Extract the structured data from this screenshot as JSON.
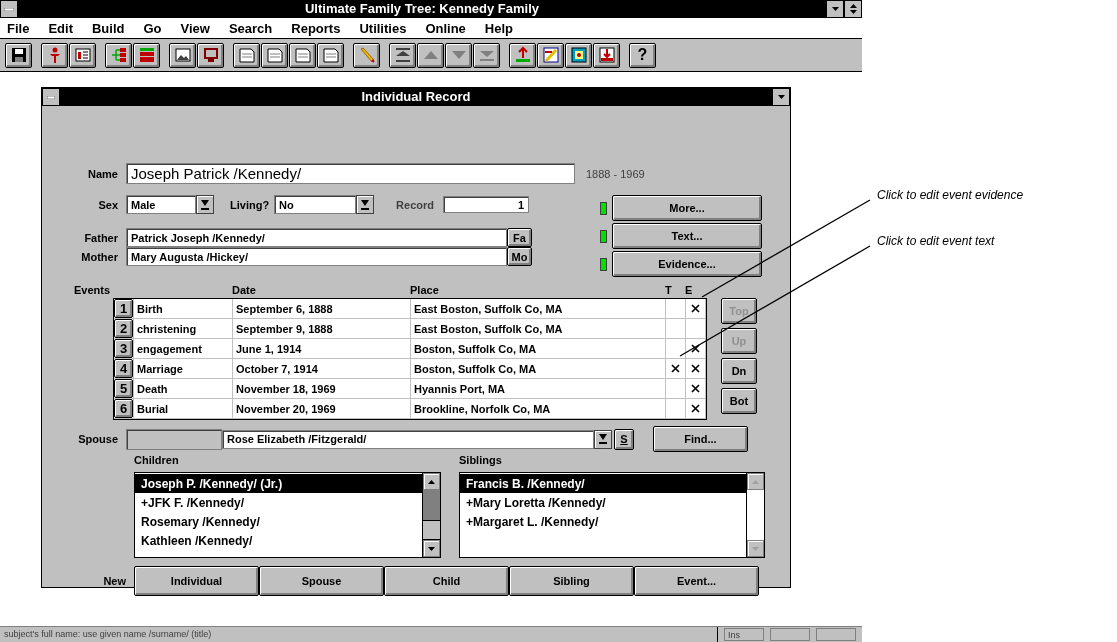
{
  "window": {
    "title": "Ultimate Family Tree: Kennedy Family"
  },
  "menu": [
    "File",
    "Edit",
    "Build",
    "Go",
    "View",
    "Search",
    "Reports",
    "Utilities",
    "Online",
    "Help"
  ],
  "toolbar": [
    [
      {
        "kind": "save"
      }
    ],
    [
      {
        "kind": "person"
      },
      {
        "kind": "card"
      }
    ],
    [
      {
        "kind": "tree"
      },
      {
        "kind": "bars"
      }
    ],
    [
      {
        "kind": "photo"
      },
      {
        "kind": "monitor"
      }
    ],
    [
      {
        "kind": "doc"
      },
      {
        "kind": "doc"
      },
      {
        "kind": "doc"
      },
      {
        "kind": "doc"
      }
    ],
    [
      {
        "kind": "pencil"
      }
    ],
    [
      {
        "kind": "top"
      },
      {
        "kind": "up"
      },
      {
        "kind": "down"
      },
      {
        "kind": "bottom"
      }
    ],
    [
      {
        "kind": "ancestor"
      },
      {
        "kind": "edit"
      },
      {
        "kind": "frame"
      },
      {
        "kind": "descend"
      }
    ],
    [
      {
        "kind": "help",
        "label": "?"
      }
    ]
  ],
  "dialog": {
    "title": "Individual Record",
    "name": {
      "label": "Name",
      "value": "Joseph Patrick /Kennedy/"
    },
    "lifespan": "1888 - 1969",
    "sex": {
      "label": "Sex",
      "value": "Male"
    },
    "living": {
      "label": "Living?",
      "value": "No"
    },
    "record": {
      "label": "Record",
      "value": "1"
    },
    "father": {
      "label": "Father",
      "value": "Patrick Joseph /Kennedy/",
      "button": "Fa"
    },
    "mother": {
      "label": "Mother",
      "value": "Mary Augusta /Hickey/",
      "button": "Mo"
    },
    "side_buttons": [
      {
        "label": "More...",
        "indicator": true
      },
      {
        "label": "Text...",
        "indicator": true
      },
      {
        "label": "Evidence...",
        "indicator": true
      }
    ],
    "events": {
      "label": "Events",
      "columns": [
        "Date",
        "Place",
        "T",
        "E"
      ],
      "rows": [
        {
          "number": "1",
          "type": "Birth",
          "date": "September 6, 1888",
          "place": "East Boston, Suffolk Co, MA",
          "text": false,
          "evidence": true
        },
        {
          "number": "2",
          "type": "christening",
          "date": "September 9, 1888",
          "place": "East Boston, Suffolk Co, MA",
          "text": false,
          "evidence": false
        },
        {
          "number": "3",
          "type": "engagement",
          "date": "June 1, 1914",
          "place": "Boston, Suffolk Co, MA",
          "text": false,
          "evidence": true
        },
        {
          "number": "4",
          "type": "Marriage",
          "date": "October 7, 1914",
          "place": "Boston, Suffolk Co, MA",
          "text": true,
          "evidence": true
        },
        {
          "number": "5",
          "type": "Death",
          "date": "November 18, 1969",
          "place": "Hyannis Port, MA",
          "text": false,
          "evidence": true
        },
        {
          "number": "6",
          "type": "Burial",
          "date": "November 20, 1969",
          "place": "Brookline, Norfolk Co, MA",
          "text": false,
          "evidence": true
        }
      ]
    },
    "order_buttons": [
      {
        "label": "Top",
        "disabled": true
      },
      {
        "label": "Up",
        "disabled": true
      },
      {
        "label": "Dn",
        "disabled": false
      },
      {
        "label": "Bot",
        "disabled": false
      }
    ],
    "spouse": {
      "label": "Spouse",
      "value": "Rose Elizabeth /Fitzgerald/",
      "button": "S"
    },
    "find_button": "Find...",
    "children": {
      "label": "Children",
      "scrollable": true,
      "items": [
        {
          "name": "Joseph P. /Kennedy/ (Jr.)",
          "selected": true
        },
        {
          "name": "+JFK F. /Kennedy/",
          "selected": false
        },
        {
          "name": "Rosemary /Kennedy/",
          "selected": false
        },
        {
          "name": "Kathleen /Kennedy/",
          "selected": false
        }
      ]
    },
    "siblings": {
      "label": "Siblings",
      "scrollable": false,
      "items": [
        {
          "name": "Francis B. /Kennedy/",
          "selected": true
        },
        {
          "name": "+Mary Loretta /Kennedy/",
          "selected": false
        },
        {
          "name": "+Margaret L. /Kennedy/",
          "selected": false
        }
      ]
    },
    "new": {
      "label": "New",
      "buttons": [
        "Individual",
        "Spouse",
        "Child",
        "Sibling",
        "Event..."
      ]
    }
  },
  "status_bar": {
    "text": "subject's full name: use given name /surname/ (title)",
    "panels": [
      "Ins"
    ]
  },
  "annotations": [
    {
      "text": "Click to edit event evidence"
    },
    {
      "text": "Click to edit event text"
    }
  ]
}
